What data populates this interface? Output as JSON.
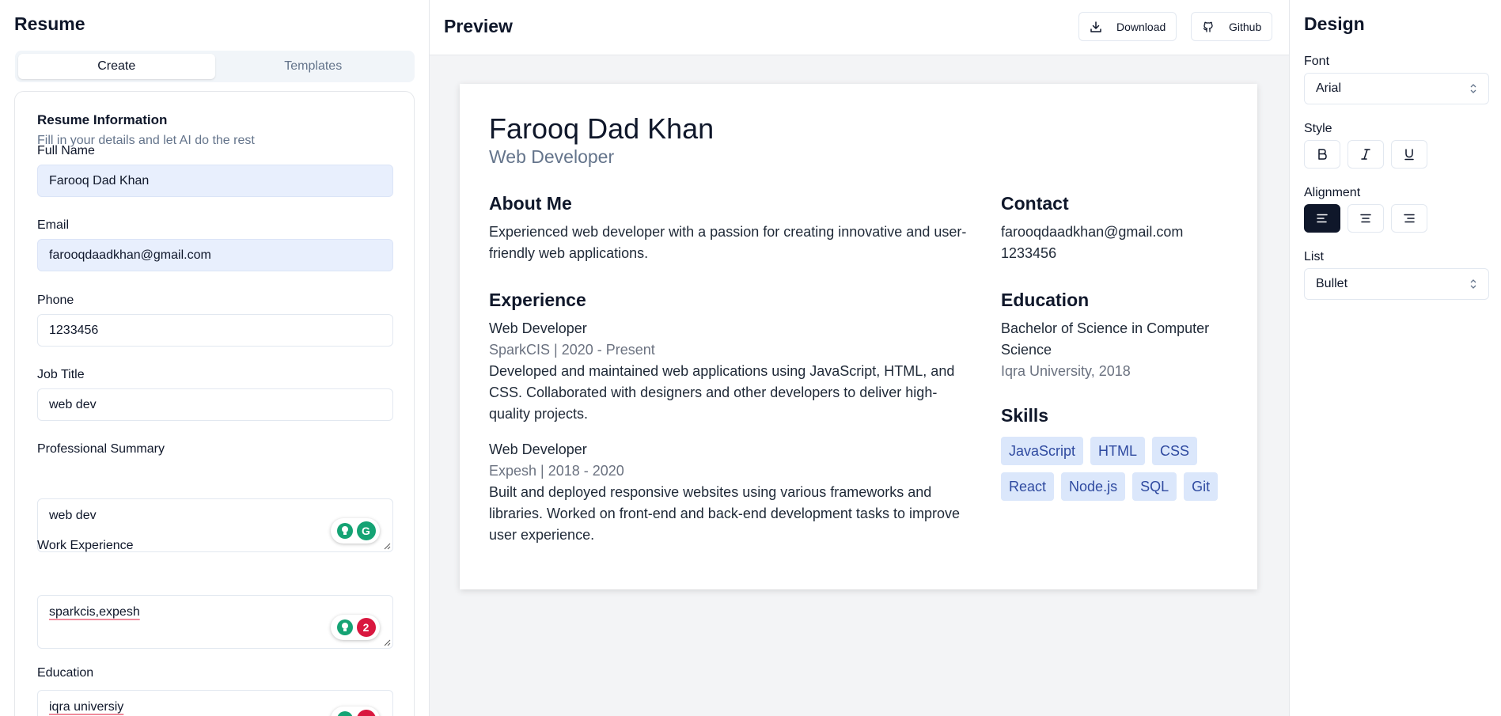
{
  "left_panel": {
    "title": "Resume",
    "tabs": [
      {
        "label": "Create",
        "active": true
      },
      {
        "label": "Templates",
        "active": false
      }
    ],
    "card": {
      "title": "Resume Information",
      "subtitle": "Fill in your details and let AI do the rest"
    },
    "fields": {
      "full_name": {
        "label": "Full Name",
        "value": "Farooq Dad Khan"
      },
      "email": {
        "label": "Email",
        "value": "farooqdaadkhan@gmail.com"
      },
      "phone": {
        "label": "Phone",
        "value": "1233456"
      },
      "job_title": {
        "label": "Job Title",
        "value": "web dev"
      },
      "summary": {
        "label": "Professional Summary",
        "value": "web dev"
      },
      "work_experience": {
        "label": "Work Experience",
        "value": "sparkcis,expesh",
        "issue_count": "2"
      },
      "education": {
        "label": "Education",
        "value": "iqra universiy"
      }
    }
  },
  "preview": {
    "title": "Preview",
    "download_label": "Download",
    "github_label": "Github",
    "resume": {
      "name": "Farooq Dad Khan",
      "job_title": "Web Developer",
      "about_heading": "About Me",
      "about_text": "Experienced web developer with a passion for creating innovative and user-friendly web applications.",
      "experience_heading": "Experience",
      "experience": [
        {
          "role": "Web Developer",
          "meta": "SparkCIS | 2020 - Present",
          "desc": "Developed and maintained web applications using JavaScript, HTML, and CSS. Collaborated with designers and other developers to deliver high-quality projects."
        },
        {
          "role": "Web Developer",
          "meta": "Expesh | 2018 - 2020",
          "desc": "Built and deployed responsive websites using various frameworks and libraries. Worked on front-end and back-end development tasks to improve user experience."
        }
      ],
      "contact_heading": "Contact",
      "contact_email": "farooqdaadkhan@gmail.com",
      "contact_phone": "1233456",
      "education_heading": "Education",
      "education_degree": "Bachelor of Science in Computer Science",
      "education_school": "Iqra University, 2018",
      "skills_heading": "Skills",
      "skills": [
        "JavaScript",
        "HTML",
        "CSS",
        "React",
        "Node.js",
        "SQL",
        "Git"
      ]
    }
  },
  "design": {
    "title": "Design",
    "font_label": "Font",
    "font_value": "Arial",
    "style_label": "Style",
    "alignment_label": "Alignment",
    "alignment_selected": "left",
    "list_label": "List",
    "list_value": "Bullet"
  },
  "colors": {
    "accent_dark": "#0f172a",
    "autofill_bg": "#e8effd",
    "skill_chip_bg": "#dbe7fb",
    "skill_chip_text": "#2f4aa0",
    "grammarly_green": "#15a374",
    "grammarly_red": "#d9173f"
  }
}
